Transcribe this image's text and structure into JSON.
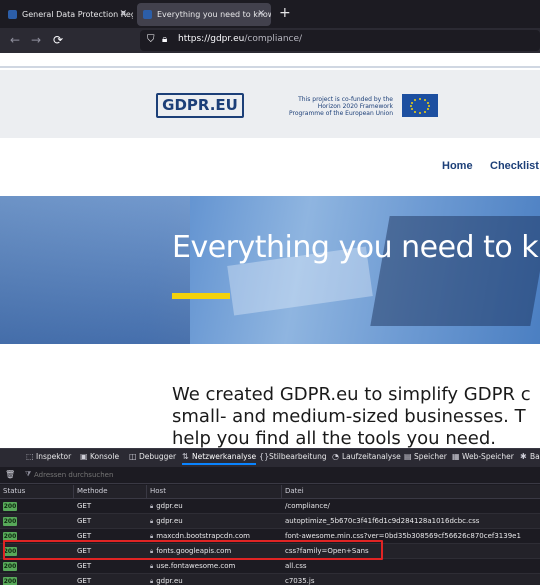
{
  "browser": {
    "tabs": [
      {
        "title": "General Data Protection Regula",
        "close": "✕"
      },
      {
        "title": "Everything you need to know a",
        "close": "✕"
      }
    ],
    "new_tab": "+",
    "back": "←",
    "forward": "→",
    "reload": "⟳",
    "url_host": "https://gdpr.eu",
    "url_path": "/compliance/"
  },
  "site": {
    "logo": "GDPR.EU",
    "cofund_text": "This project is co-funded by the Horizon 2020 Framework Programme of the European Union",
    "menu": [
      "Home",
      "Checklist"
    ],
    "hero_title": "Everything you need to know",
    "intro_lines": [
      "We created GDPR.eu to simplify GDPR c",
      "small- and medium-sized businesses. T",
      "help you find all the tools you need."
    ]
  },
  "devtools": {
    "tabs": [
      {
        "icon": "⬚",
        "label": "Inspektor"
      },
      {
        "icon": "▣",
        "label": "Konsole"
      },
      {
        "icon": "◫",
        "label": "Debugger"
      },
      {
        "icon": "⇅",
        "label": "Netzwerkanalyse"
      },
      {
        "icon": "{}",
        "label": "Stilbearbeitung"
      },
      {
        "icon": "◔",
        "label": "Laufzeitanalyse"
      },
      {
        "icon": "▤",
        "label": "Speicher"
      },
      {
        "icon": "▦",
        "label": "Web-Speicher"
      },
      {
        "icon": "✱",
        "label": "Ba"
      }
    ],
    "trash_icon": "🗑",
    "filter_placeholder": "Adressen durchsuchen",
    "columns": [
      "Status",
      "Methode",
      "Host",
      "Datei"
    ],
    "rows": [
      {
        "status": "200",
        "method": "GET",
        "host": "gdpr.eu",
        "file": "/compliance/"
      },
      {
        "status": "200",
        "method": "GET",
        "host": "gdpr.eu",
        "file": "autoptimize_5b670c3f41f6d1c9d284128a1016dcbc.css"
      },
      {
        "status": "200",
        "method": "GET",
        "host": "maxcdn.bootstrapcdn.com",
        "file": "font-awesome.min.css?ver=0bd35b308569cf56626c870cef3139e1"
      },
      {
        "status": "200",
        "method": "GET",
        "host": "fonts.googleapis.com",
        "file": "css?family=Open+Sans"
      },
      {
        "status": "200",
        "method": "GET",
        "host": "use.fontawesome.com",
        "file": "all.css"
      },
      {
        "status": "200",
        "method": "GET",
        "host": "gdpr.eu",
        "file": "c7035.js"
      }
    ]
  }
}
